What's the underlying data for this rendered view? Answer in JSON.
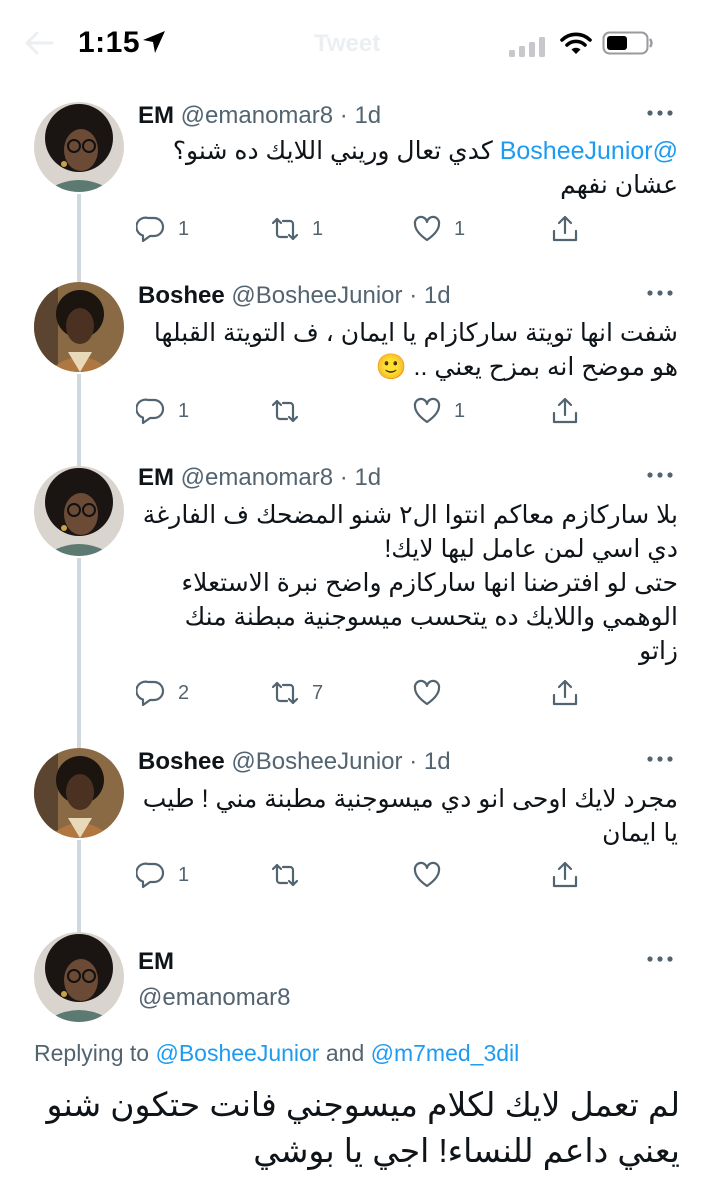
{
  "status_bar": {
    "time": "1:15",
    "ghost_title": "Tweet"
  },
  "tweets": [
    {
      "name": "EM",
      "handle": "@emanomar8",
      "sep": "·",
      "time": "1d",
      "text_mention": "@BosheeJunior",
      "text_line1_rest": " كدي تعال وريني اللايك ده شنو؟",
      "text_line2": "عشان نفهم",
      "replies": "1",
      "retweets": "1",
      "likes": "1"
    },
    {
      "name": "Boshee",
      "handle": "@BosheeJunior",
      "sep": "·",
      "time": "1d",
      "text_line1": "شفت انها تويتة ساركازام يا ايمان ، ف التويتة القبلها",
      "text_line2": "هو موضح انه بمزح يعني .. 🙂",
      "replies": "1",
      "retweets": "",
      "likes": "1"
    },
    {
      "name": "EM",
      "handle": "@emanomar8",
      "sep": "·",
      "time": "1d",
      "text_line1": "بلا ساركازم معاكم انتوا ال٢ شنو المضحك ف الفارغة",
      "text_line2": "دي اسي لمن عامل ليها لايك!",
      "text_line3": "حتى لو افترضنا انها ساركازم واضح نبرة الاستعلاء",
      "text_line4": "الوهمي واللايك ده يتحسب ميسوجنية مبطنة منك",
      "text_line5": "زاتو",
      "replies": "2",
      "retweets": "7",
      "likes": ""
    },
    {
      "name": "Boshee",
      "handle": "@BosheeJunior",
      "sep": "·",
      "time": "1d",
      "text_line1": "مجرد لايك اوحى انو دي ميسوجنية مطبنة مني ! طيب",
      "text_line2": "يا ايمان",
      "replies": "1",
      "retweets": "",
      "likes": ""
    }
  ],
  "main_tweet": {
    "name": "EM",
    "handle": "@emanomar8",
    "replying_prefix": "Replying to",
    "replying_user1": "@BosheeJunior",
    "replying_and": "and",
    "replying_user2": "@m7med_3dil",
    "text_line1": "لم تعمل لايك لكلام ميسوجني فانت حتكون شنو",
    "text_line2": "يعني داعم للنساء! اجي يا بوشي"
  },
  "icons": {
    "reply": "reply-icon",
    "retweet": "retweet-icon",
    "like": "heart-icon",
    "share": "share-icon",
    "more": "more-dots-icon"
  },
  "colors": {
    "accent": "#1d9bf0",
    "secondary_text": "#536471",
    "thread_line": "#cfd9de"
  }
}
